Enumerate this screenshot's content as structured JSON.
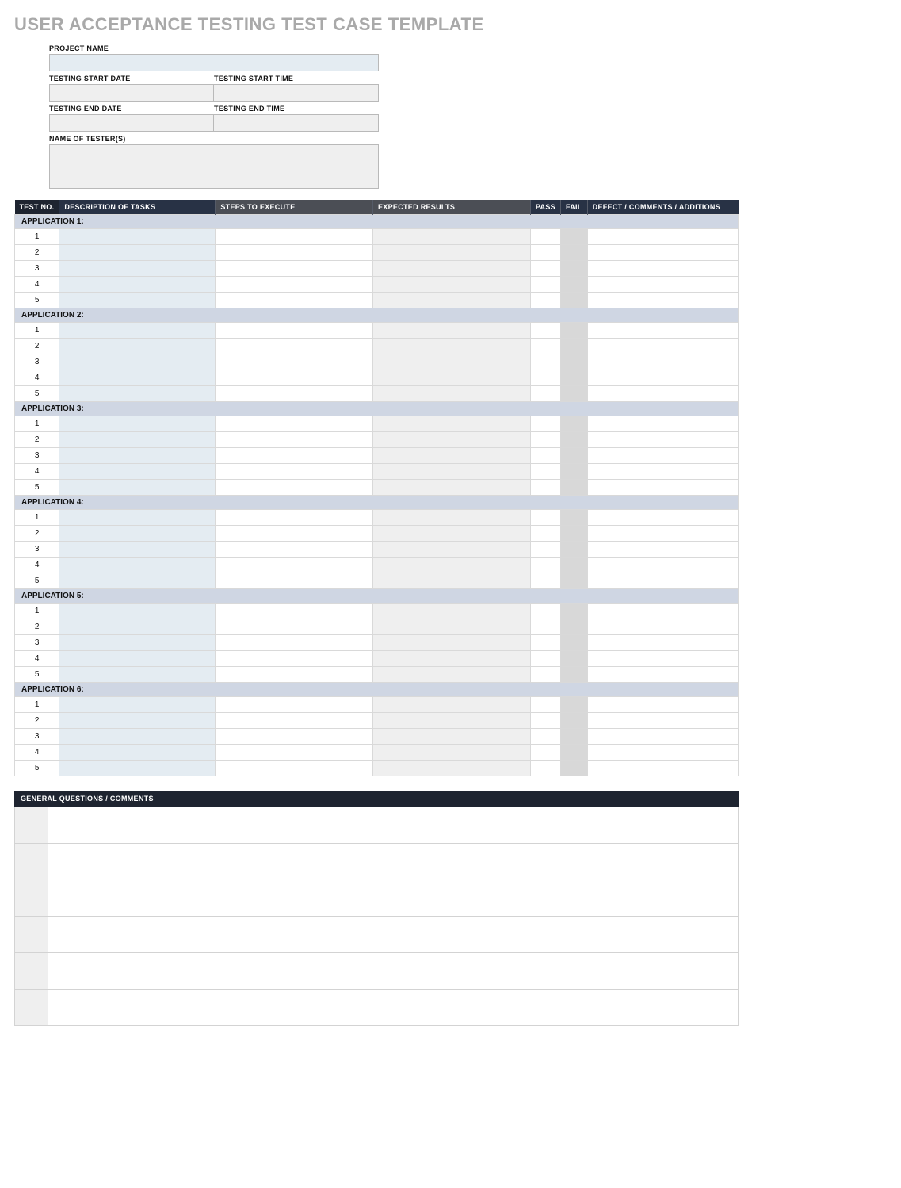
{
  "title": "USER ACCEPTANCE TESTING TEST CASE TEMPLATE",
  "meta": {
    "project_name_label": "PROJECT NAME",
    "start_date_label": "TESTING START DATE",
    "start_time_label": "TESTING START TIME",
    "end_date_label": "TESTING END DATE",
    "end_time_label": "TESTING END TIME",
    "testers_label": "NAME OF TESTER(S)",
    "project_name": "",
    "start_date": "",
    "start_time": "",
    "end_date": "",
    "end_time": "",
    "testers": ""
  },
  "columns": {
    "test_no": "TEST NO.",
    "description": "DESCRIPTION OF TASKS",
    "steps": "STEPS TO EXECUTE",
    "expected": "EXPECTED RESULTS",
    "pass": "PASS",
    "fail": "FAIL",
    "defect": "DEFECT / COMMENTS / ADDITIONS"
  },
  "groups": [
    {
      "label": "APPLICATION 1:",
      "rows": [
        "1",
        "2",
        "3",
        "4",
        "5"
      ]
    },
    {
      "label": "APPLICATION 2:",
      "rows": [
        "1",
        "2",
        "3",
        "4",
        "5"
      ]
    },
    {
      "label": "APPLICATION 3:",
      "rows": [
        "1",
        "2",
        "3",
        "4",
        "5"
      ]
    },
    {
      "label": "APPLICATION 4:",
      "rows": [
        "1",
        "2",
        "3",
        "4",
        "5"
      ]
    },
    {
      "label": "APPLICATION 5:",
      "rows": [
        "1",
        "2",
        "3",
        "4",
        "5"
      ]
    },
    {
      "label": "APPLICATION 6:",
      "rows": [
        "1",
        "2",
        "3",
        "4",
        "5"
      ]
    }
  ],
  "general_questions_header": "GENERAL QUESTIONS / COMMENTS",
  "general_questions_rows": 6
}
